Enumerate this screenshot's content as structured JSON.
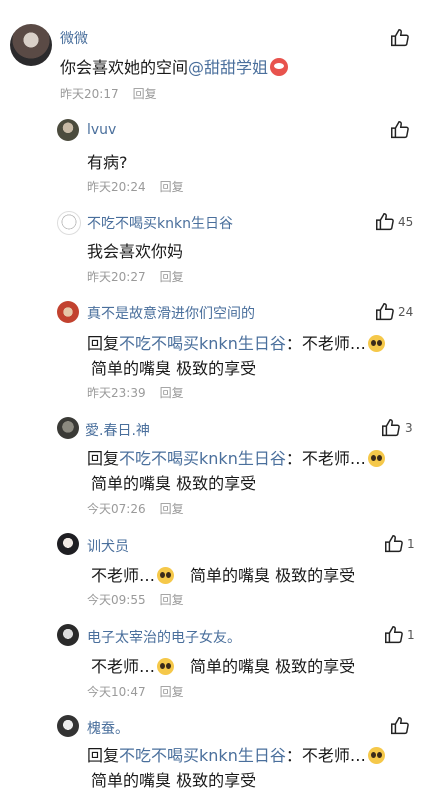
{
  "main": {
    "user": "微微",
    "text_prefix": "你会喜欢她的空间",
    "mention": "@甜甜学姐",
    "time": "昨天20:17",
    "reply": "回复"
  },
  "replies": [
    {
      "user": "lvuv",
      "line1": "有病?",
      "time": "昨天20:24",
      "reply": "回复",
      "likes": ""
    },
    {
      "user": "不吃不喝买knkn生日谷",
      "line1": "我会喜欢你妈",
      "time": "昨天20:27",
      "reply": "回复",
      "likes": "45"
    },
    {
      "user": "真不是故意滑进你们空间的",
      "line1_prefix": "回复",
      "line1_mention": "不吃不喝买knkn生日谷",
      "line1_suffix": "：不老师…",
      "line2": "简单的嘴臭 极致的享受",
      "time": "昨天23:39",
      "reply": "回复",
      "likes": "24"
    },
    {
      "user": "愛.春日.神",
      "line1_prefix": "回复",
      "line1_mention": "不吃不喝买knkn生日谷",
      "line1_suffix": "：不老师…",
      "line2": "简单的嘴臭 极致的享受",
      "time": "今天07:26",
      "reply": "回复",
      "likes": "3"
    },
    {
      "user": "训犬员",
      "line1_a": "不老师…",
      "line1_b": "简单的嘴臭 极致的享受",
      "time": "今天09:55",
      "reply": "回复",
      "likes": "1"
    },
    {
      "user": "电子太宰治的电子女友。",
      "line1_a": "不老师…",
      "line1_b": "简单的嘴臭 极致的享受",
      "time": "今天10:47",
      "reply": "回复",
      "likes": "1"
    },
    {
      "user": "槐蚕。",
      "line1_prefix": "回复",
      "line1_mention": "不吃不喝买knkn生日谷",
      "line1_suffix": "：不老师…",
      "line2": "简单的嘴臭 极致的享受",
      "likes": ""
    }
  ],
  "icons": {
    "like": "thumbs-up-icon",
    "emoji": "pleading-face-emoji",
    "emoji_red": "shocked-face-emoji"
  },
  "colors": {
    "username": "#4a6f9c",
    "meta": "#9a9a9a",
    "text": "#1a1a1a"
  }
}
